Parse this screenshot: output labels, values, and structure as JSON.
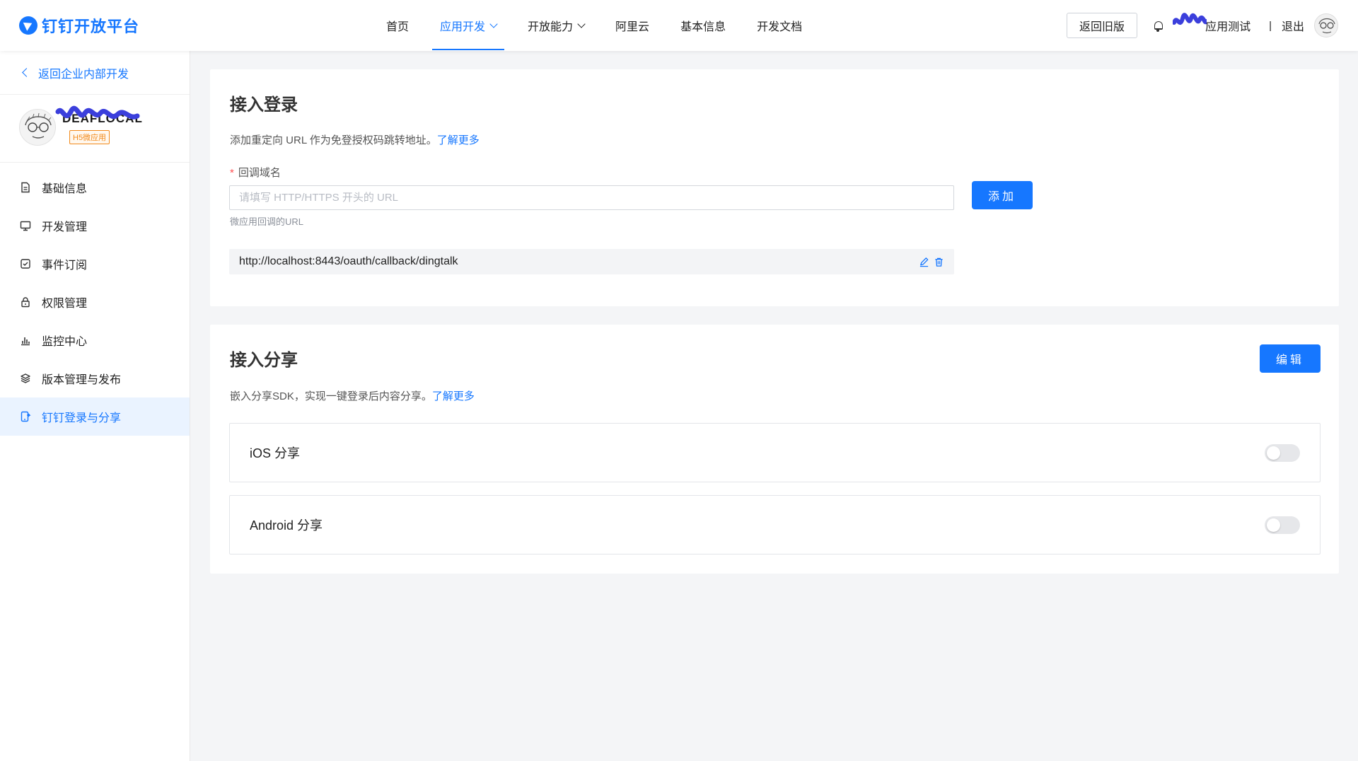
{
  "brand": {
    "name": "钉钉开放平台",
    "color": "#1677ff"
  },
  "nav": {
    "items": [
      {
        "label": "首页",
        "active": false,
        "dropdown": false
      },
      {
        "label": "应用开发",
        "active": true,
        "dropdown": true
      },
      {
        "label": "开放能力",
        "active": false,
        "dropdown": true
      },
      {
        "label": "阿里云",
        "active": false,
        "dropdown": false
      },
      {
        "label": "基本信息",
        "active": false,
        "dropdown": false
      },
      {
        "label": "开发文档",
        "active": false,
        "dropdown": false
      }
    ],
    "old_version_label": "返回旧版",
    "org_suffix": "应用测试",
    "separator": "|",
    "logout_label": "退出"
  },
  "sidebar": {
    "back_label": "返回企业内部开发",
    "app_name": "DEAFLOCAL",
    "app_badge": "H5微应用",
    "items": [
      {
        "label": "基础信息",
        "icon": "document-icon",
        "active": false
      },
      {
        "label": "开发管理",
        "icon": "monitor-icon",
        "active": false
      },
      {
        "label": "事件订阅",
        "icon": "checkbox-icon",
        "active": false
      },
      {
        "label": "权限管理",
        "icon": "lock-icon",
        "active": false
      },
      {
        "label": "监控中心",
        "icon": "bar-chart-icon",
        "active": false
      },
      {
        "label": "版本管理与发布",
        "icon": "layers-icon",
        "active": false
      },
      {
        "label": "钉钉登录与分享",
        "icon": "phone-share-icon",
        "active": true
      }
    ]
  },
  "login": {
    "title": "接入登录",
    "desc": "添加重定向 URL 作为免登授权码跳转地址。",
    "learn_more": "了解更多",
    "field_label": "回调域名",
    "required_mark": "*",
    "placeholder": "请填写 HTTP/HTTPS 开头的 URL",
    "value": "",
    "add_label": "添加",
    "hint": "微应用回调的URL",
    "urls": [
      "http://localhost:8443/oauth/callback/dingtalk"
    ]
  },
  "share": {
    "title": "接入分享",
    "edit_label": "编辑",
    "desc": "嵌入分享SDK，实现一键登录后内容分享。",
    "learn_more": "了解更多",
    "rows": [
      {
        "label": "iOS 分享",
        "enabled": false
      },
      {
        "label": "Android 分享",
        "enabled": false
      }
    ]
  },
  "colors": {
    "accent": "#1677ff",
    "badge": "#f28a1b",
    "required": "#ff4d4f",
    "redaction": "#3b3fdc"
  }
}
